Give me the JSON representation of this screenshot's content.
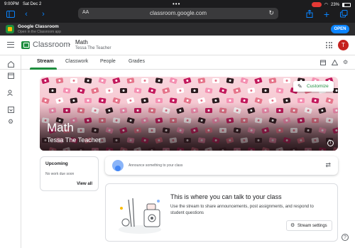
{
  "status_bar": {
    "time": "9:00PM",
    "date": "Sat Dec 2",
    "battery": "23%"
  },
  "browser": {
    "text_size_label": "AA",
    "url": "classroom.google.com",
    "banner_app_name": "Google Classroom",
    "banner_subtitle": "Open in the Classroom app",
    "open_label": "OPEN"
  },
  "header": {
    "app_name": "Classroom",
    "class_name": "Math",
    "teacher": "Tessa The Teacher",
    "avatar_initial": "T"
  },
  "tabs": [
    {
      "label": "Stream",
      "active": true
    },
    {
      "label": "Classwork",
      "active": false
    },
    {
      "label": "People",
      "active": false
    },
    {
      "label": "Grades",
      "active": false
    }
  ],
  "hero": {
    "title": "Math",
    "subtitle": "Tessa The Teacher",
    "customize_label": "Customize"
  },
  "upcoming": {
    "heading": "Upcoming",
    "empty_text": "No work due soon",
    "view_all_label": "View all"
  },
  "announce": {
    "placeholder": "Announce something to your class"
  },
  "stream_info": {
    "heading": "This is where you can talk to your class",
    "description": "Use the stream to share announcements, post assignments, and respond to student questions",
    "settings_label": "Stream settings"
  },
  "colors": {
    "brand_green": "#1e8e3e",
    "safari_accent": "#0a84ff",
    "avatar": "#c5221f"
  }
}
